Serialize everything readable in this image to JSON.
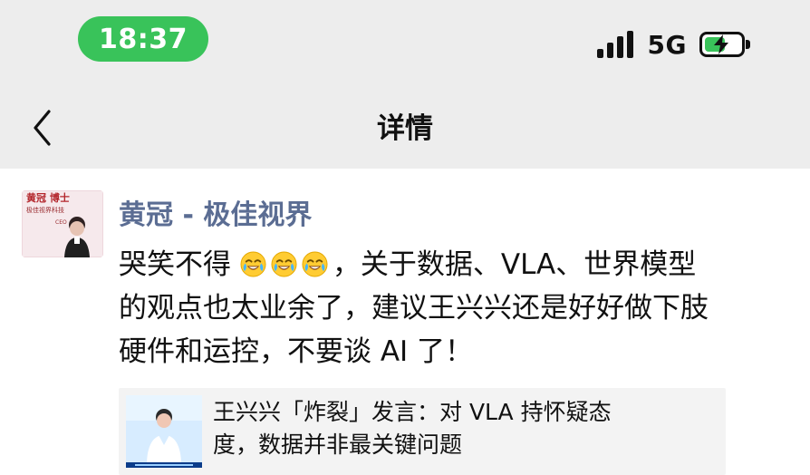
{
  "status_bar": {
    "time": "18:37",
    "network": "5G",
    "signal_bars": 4,
    "battery_level": 0.58,
    "colors": {
      "accent": "#39c35a"
    }
  },
  "nav": {
    "title": "详情",
    "back_icon": "chevron-left-icon"
  },
  "post": {
    "author": "黄冠 - 极佳视界",
    "lines": {
      "line1_prefix": "哭笑不得",
      "line1_suffix": "，关于数据、VLA、世界模型",
      "line2": "的观点也太业余了，建议王兴兴还是好好做下肢",
      "line3": "硬件和运控，不要谈 AI 了！"
    },
    "emojis": [
      "laughing-crying-emoji",
      "laughing-crying-emoji",
      "laughing-crying-emoji"
    ],
    "avatar_text": {
      "title_line": "黄冠  博士",
      "company_line": "极佳视界科技",
      "role": "CEO"
    }
  },
  "link_card": {
    "title_line1": "王兴兴「炸裂」发言：对 VLA 持怀疑态",
    "title_line2": "度，数据并非最关键问题"
  }
}
